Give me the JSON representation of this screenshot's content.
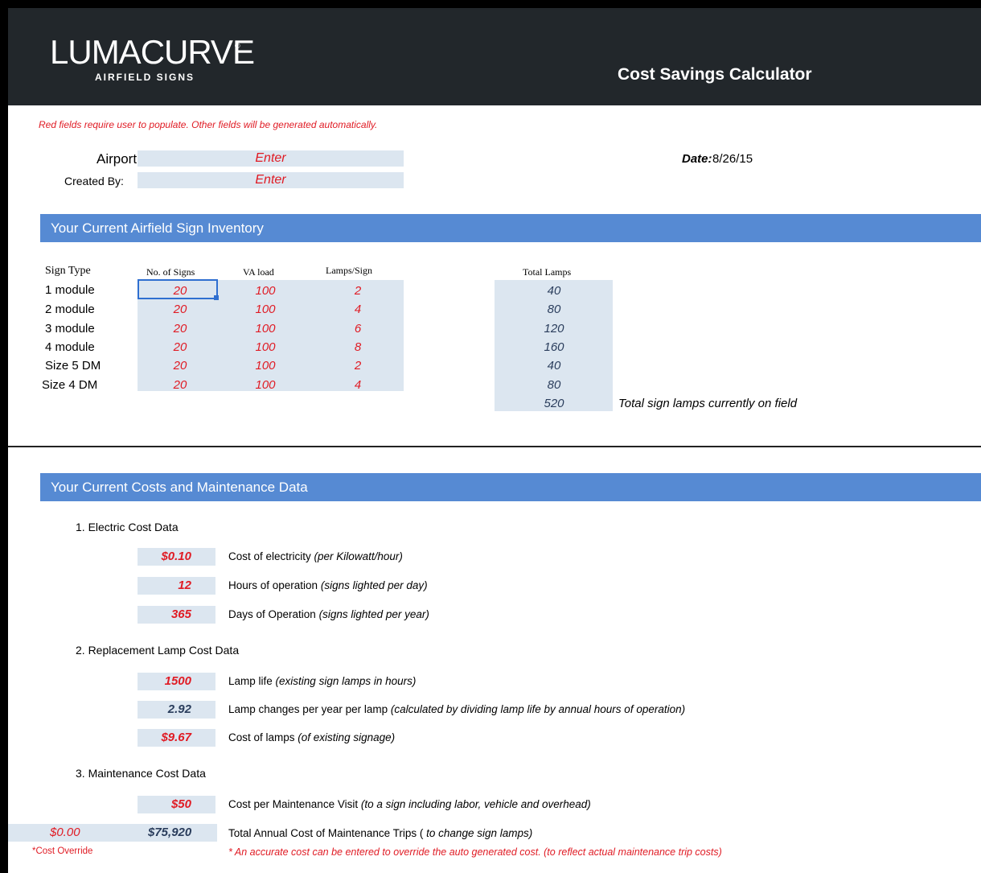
{
  "brand": {
    "logo_main": "LUMACURVE",
    "logo_reg": "®",
    "logo_sub": "AIRFIELD SIGNS",
    "title": "Cost Savings Calculator"
  },
  "note": "Red fields require user to populate.  Other fields will be generated automatically.",
  "info": {
    "airport_label": "Airport:",
    "airport_value": "Enter",
    "created_label": "Created By:",
    "created_value": "Enter",
    "date_label": "Date:",
    "date_value": "8/26/15"
  },
  "inventory": {
    "section_title": "Your Current Airfield Sign Inventory",
    "headers": {
      "type": "Sign Type",
      "signs": "No. of Signs",
      "va": "VA load",
      "lamps": "Lamps/Sign",
      "total": "Total Lamps"
    },
    "rows": [
      {
        "type": "1 module",
        "signs": "20",
        "va": "100",
        "lamps": "2",
        "total": "40"
      },
      {
        "type": "2 module",
        "signs": "20",
        "va": "100",
        "lamps": "4",
        "total": "80"
      },
      {
        "type": "3 module",
        "signs": "20",
        "va": "100",
        "lamps": "6",
        "total": "120"
      },
      {
        "type": "4 module",
        "signs": "20",
        "va": "100",
        "lamps": "8",
        "total": "160"
      },
      {
        "type": "Size 5 DM",
        "signs": "20",
        "va": "100",
        "lamps": "2",
        "total": "40"
      },
      {
        "type": "Size 4 DM",
        "signs": "20",
        "va": "100",
        "lamps": "4",
        "total": "80"
      }
    ],
    "grand_total": "520",
    "grand_total_label": "Total sign lamps currently on field"
  },
  "costs": {
    "section_title": "Your Current Costs and Maintenance Data",
    "electric": {
      "heading": "1.  Electric Cost Data",
      "items": [
        {
          "value": "$0.10",
          "label": "Cost of electricity",
          "hint": "(per Kilowatt/hour)"
        },
        {
          "value": "12",
          "label": "Hours of operation",
          "hint": "(signs lighted per day)"
        },
        {
          "value": "365",
          "label": "Days of Operation",
          "hint": "(signs lighted per year)"
        }
      ]
    },
    "lamp": {
      "heading": "2.  Replacement Lamp Cost Data",
      "items": [
        {
          "value": "1500",
          "label": "Lamp life",
          "hint": "(existing sign lamps in hours)"
        },
        {
          "value": "2.92",
          "label": "Lamp changes per year per lamp",
          "hint": "(calculated by dividing lamp life by annual hours of operation)"
        },
        {
          "value": "$9.67",
          "label": "Cost of lamps",
          "hint": "(of existing signage)"
        }
      ]
    },
    "maintenance": {
      "heading": "3.  Maintenance Cost Data",
      "visit_value": "$50",
      "visit_label": "Cost per Maintenance Visit",
      "visit_hint": "(to a sign including labor, vehicle and overhead)",
      "override_value": "$0.00",
      "annual_value": "$75,920",
      "annual_label": "Total Annual Cost of Maintenance Trips",
      "annual_hint_open": "( ",
      "annual_hint": "to change sign lamps)",
      "override_label": "*Cost Override",
      "override_note": "* An accurate cost can be entered to override the auto generated cost. (to reflect actual maintenance trip costs)"
    }
  },
  "colors": {
    "header": "#22272b",
    "band": "#568ad3",
    "input_fill": "#dce6f0",
    "red": "#e01b24",
    "computed": "#2a3d5c"
  }
}
